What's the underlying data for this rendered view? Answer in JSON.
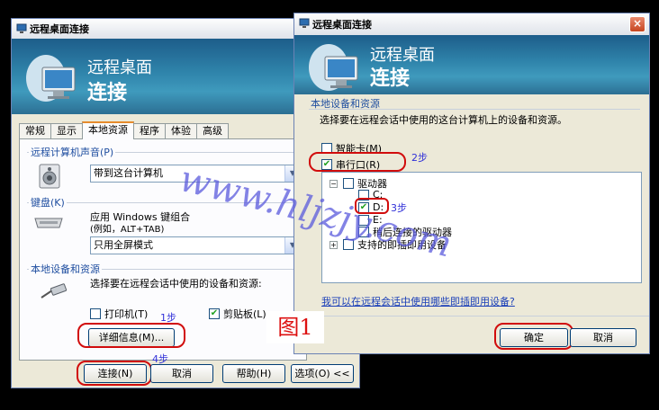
{
  "left_window": {
    "title": "远程桌面连接",
    "banner_line1": "远程桌面",
    "banner_line2": "连接",
    "tabs": [
      "常规",
      "显示",
      "本地资源",
      "程序",
      "体验",
      "高级"
    ],
    "sound_group": "远程计算机声音(P)",
    "sound_value": "带到这台计算机",
    "keyboard_group": "键盘(K)",
    "keyboard_desc_line1": "应用 Windows 键组合",
    "keyboard_desc_line2": "(例如，ALT+TAB)",
    "keyboard_value": "只用全屏模式",
    "devices_group": "本地设备和资源",
    "devices_desc": "选择要在远程会话中使用的设备和资源:",
    "printer_label": "打印机(T)",
    "printer_checked": false,
    "clipboard_label": "剪贴板(L)",
    "clipboard_checked": true,
    "details_button": "详细信息(M)...",
    "step1": "1步",
    "step4": "4步",
    "buttons": {
      "connect": "连接(N)",
      "cancel": "取消",
      "help": "帮助(H)",
      "options": "选项(O) <<"
    }
  },
  "right_window": {
    "title": "远程桌面连接",
    "close_glyph": "×",
    "banner_line1": "远程桌面",
    "banner_line2": "连接",
    "devices_group": "本地设备和资源",
    "devices_desc": "选择要在远程会话中使用的这台计算机上的设备和资源。",
    "smartcard_label": "智能卡(M)",
    "smartcard_checked": false,
    "serial_label": "串行口(R)",
    "serial_checked": true,
    "step2": "2步",
    "tree": {
      "drives": "驱动器",
      "drive_c": "C:",
      "drive_d": "D:",
      "drive_e": "E:",
      "later_drives": "稍后连接的驱动器",
      "pnp": "支持的即插即用设备"
    },
    "step3": "3步",
    "link": "我可以在远程会话中使用哪些即插即用设备?",
    "ok_button": "确定",
    "cancel_button": "取消"
  },
  "watermark": "www.hljzjy.com",
  "figure_label": "图1",
  "colors": {
    "banner": "#2f84ab",
    "highlight_oval": "#d10c0c",
    "step_note": "#2f2fd8",
    "check_mark": "#21a121"
  }
}
